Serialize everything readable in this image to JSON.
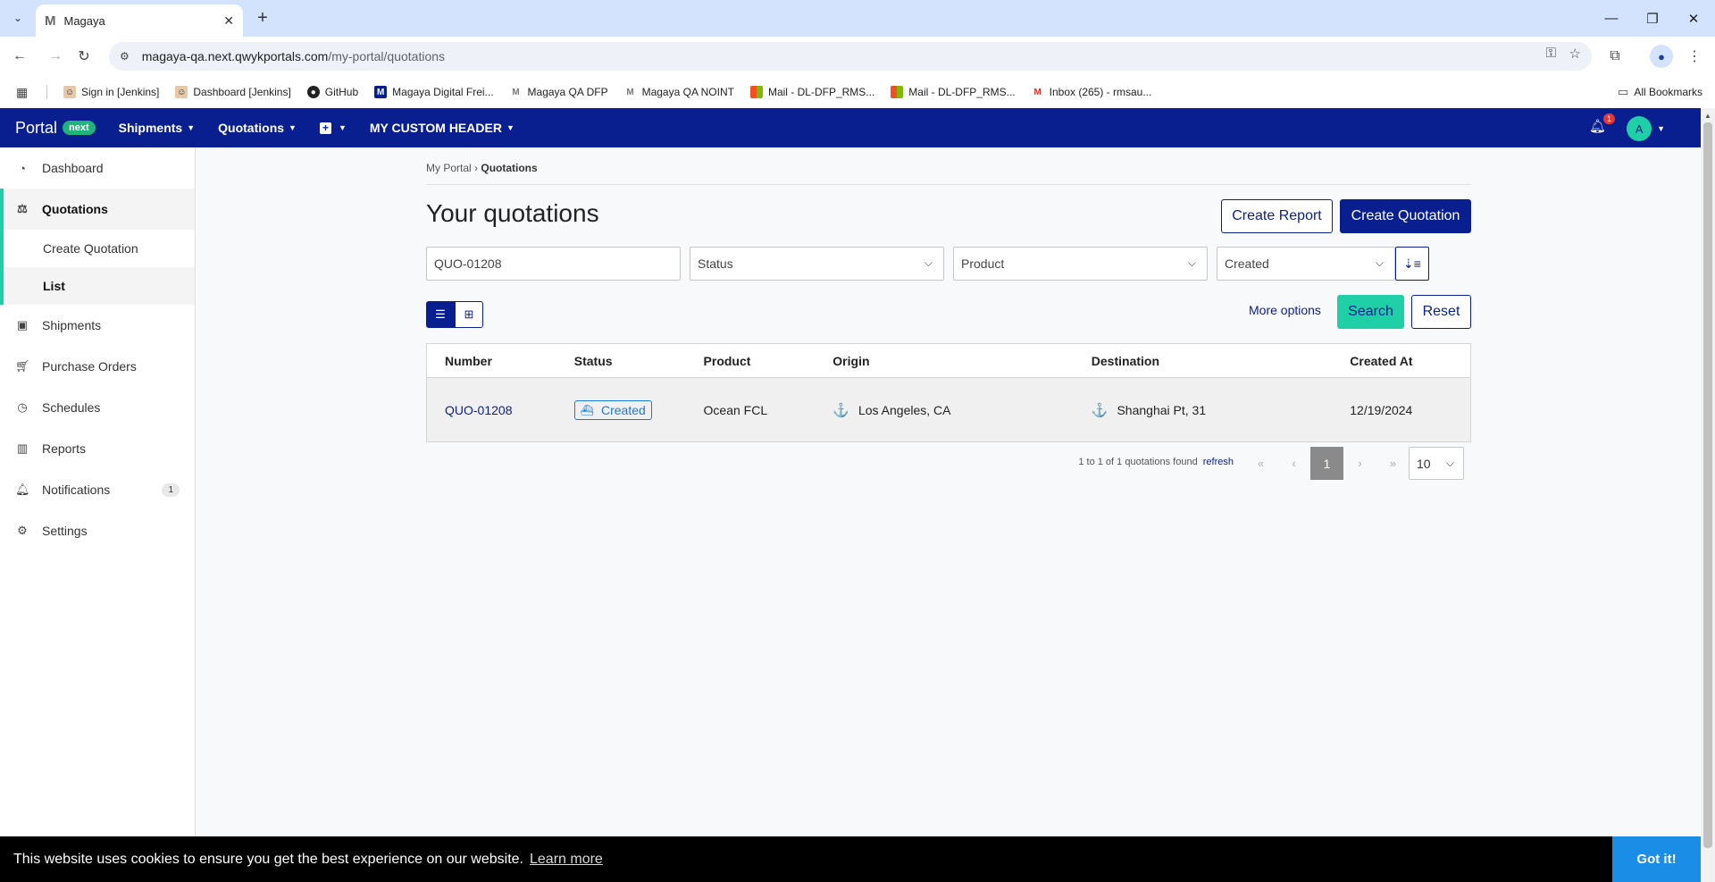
{
  "browser": {
    "tab_title": "Magaya",
    "tab_favicon": "M",
    "url_host": "magaya-qa.next.qwykportals.com",
    "url_path": "/my-portal/quotations",
    "bookmarks": [
      {
        "label": "Sign in [Jenkins]",
        "icon": "jenkins-icon"
      },
      {
        "label": "Dashboard [Jenkins]",
        "icon": "jenkins-icon"
      },
      {
        "label": "GitHub",
        "icon": "github-icon"
      },
      {
        "label": "Magaya Digital Frei...",
        "icon": "magaya-icon"
      },
      {
        "label": "Magaya QA DFP",
        "icon": "magaya-icon"
      },
      {
        "label": "Magaya QA NOINT",
        "icon": "magaya-icon"
      },
      {
        "label": "Mail - DL-DFP_RMS...",
        "icon": "microsoft-icon"
      },
      {
        "label": "Mail - DL-DFP_RMS...",
        "icon": "microsoft-icon"
      },
      {
        "label": "Inbox (265) - rmsau...",
        "icon": "gmail-icon"
      }
    ],
    "all_bookmarks": "All Bookmarks"
  },
  "appnav": {
    "brand": "Portal",
    "brand_badge": "next",
    "items": [
      "Shipments",
      "Quotations"
    ],
    "custom_header": "MY CUSTOM HEADER",
    "notification_count": "1",
    "avatar_initial": "A"
  },
  "sidebar": {
    "items": [
      {
        "label": "Dashboard",
        "icon": "dashboard-icon"
      },
      {
        "label": "Quotations",
        "icon": "quotations-icon"
      },
      {
        "label": "Create Quotation"
      },
      {
        "label": "List"
      },
      {
        "label": "Shipments",
        "icon": "shipments-icon"
      },
      {
        "label": "Purchase Orders",
        "icon": "cart-icon"
      },
      {
        "label": "Schedules",
        "icon": "clock-icon"
      },
      {
        "label": "Reports",
        "icon": "chart-icon"
      },
      {
        "label": "Notifications",
        "icon": "bell-icon",
        "count": "1"
      },
      {
        "label": "Settings",
        "icon": "gear-icon"
      }
    ]
  },
  "main": {
    "breadcrumb_root": "My Portal",
    "breadcrumb_current": "Quotations",
    "title": "Your quotations",
    "create_report": "Create Report",
    "create_quotation": "Create Quotation",
    "filters": {
      "search_value": "QUO-01208",
      "status_placeholder": "Status",
      "product_placeholder": "Product",
      "sort_value": "Created"
    },
    "more_options": "More options",
    "search_button": "Search",
    "reset_button": "Reset",
    "table": {
      "headers": [
        "Number",
        "Status",
        "Product",
        "Origin",
        "Destination",
        "Created At"
      ],
      "rows": [
        {
          "number": "QUO-01208",
          "status": "Created",
          "product": "Ocean FCL",
          "origin": "Los Angeles, CA",
          "destination": "Shanghai Pt, 31",
          "created_at": "12/19/2024"
        }
      ]
    },
    "pagination": {
      "summary": "1 to 1 of 1 quotations found",
      "refresh": "refresh",
      "current_page": "1",
      "page_size": "10"
    }
  },
  "cookie": {
    "message": "This website uses cookies to ensure you get the best experience on our website.",
    "learn_more": "Learn more",
    "got_it": "Got it!"
  },
  "colors": {
    "brand_navy": "#0a1f8f",
    "accent_teal": "#1fcfa6",
    "status_blue": "#1a7ad9"
  }
}
